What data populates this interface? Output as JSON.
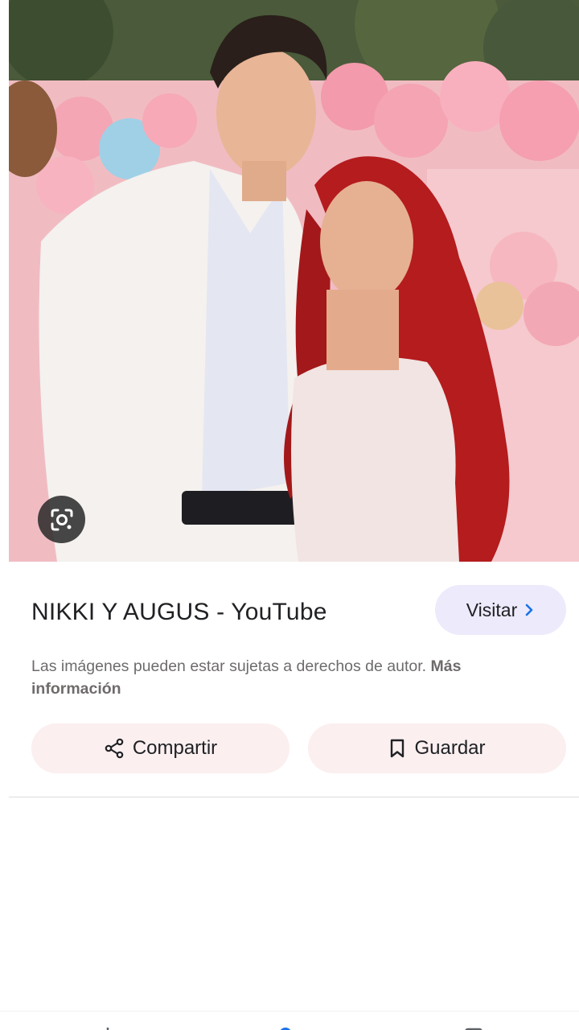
{
  "result": {
    "title": "NIKKI Y AUGUS - YouTube",
    "visit_label": "Visitar",
    "copyright_text": "Las imágenes pueden estar sujetas a derechos de autor.",
    "more_info_label": "Más información",
    "share_label": "Compartir",
    "save_label": "Guardar"
  },
  "colors": {
    "visit_bg": "#eceafb",
    "action_bg": "#fbeff0",
    "accent": "#1a73e8"
  },
  "icons": {
    "lens": "google-lens-icon",
    "share": "share-icon",
    "save": "bookmark-icon",
    "chevron": "chevron-right-icon"
  }
}
